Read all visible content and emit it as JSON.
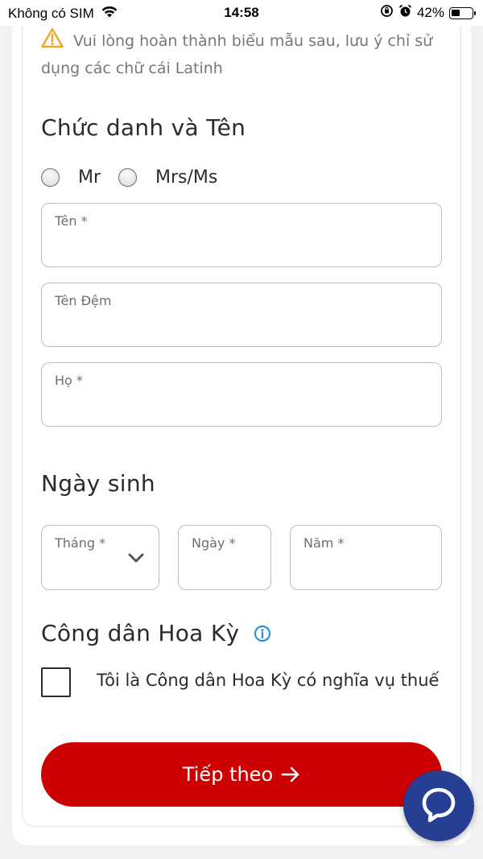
{
  "status_bar": {
    "carrier": "Không có SIM",
    "time": "14:58",
    "battery": "42%",
    "battery_level": 0.42
  },
  "notice": {
    "text": "Vui lòng hoàn thành biểu mẫu sau, lưu ý chỉ sử dụng các chữ cái Latinh",
    "icon": "warning-icon",
    "icon_color": "#f0a52a"
  },
  "name_section": {
    "title": "Chức danh và Tên",
    "titles": [
      "Mr",
      "Mrs/Ms"
    ],
    "first_name": {
      "label": "Tên *",
      "value": ""
    },
    "middle_name": {
      "label": "Tên Đệm",
      "value": ""
    },
    "last_name": {
      "label": "Họ *",
      "value": ""
    }
  },
  "dob_section": {
    "title": "Ngày sinh",
    "month": {
      "label": "Tháng *",
      "value": ""
    },
    "day": {
      "label": "Ngày *",
      "value": ""
    },
    "year": {
      "label": "Năm *",
      "value": ""
    }
  },
  "citizen_section": {
    "title": "Công dân Hoa Kỳ",
    "info_icon": "info-icon",
    "checkbox_label": "Tôi là Công dân Hoa Kỳ có nghĩa vụ thuế",
    "checked": false
  },
  "next_button": {
    "label": "Tiếp theo"
  },
  "chat_button": {
    "icon": "chat-bubble-icon"
  },
  "colors": {
    "primary": "#cc0000",
    "chat_fab": "#273f92",
    "info": "#1a8cd8",
    "warning": "#f0a52a"
  }
}
